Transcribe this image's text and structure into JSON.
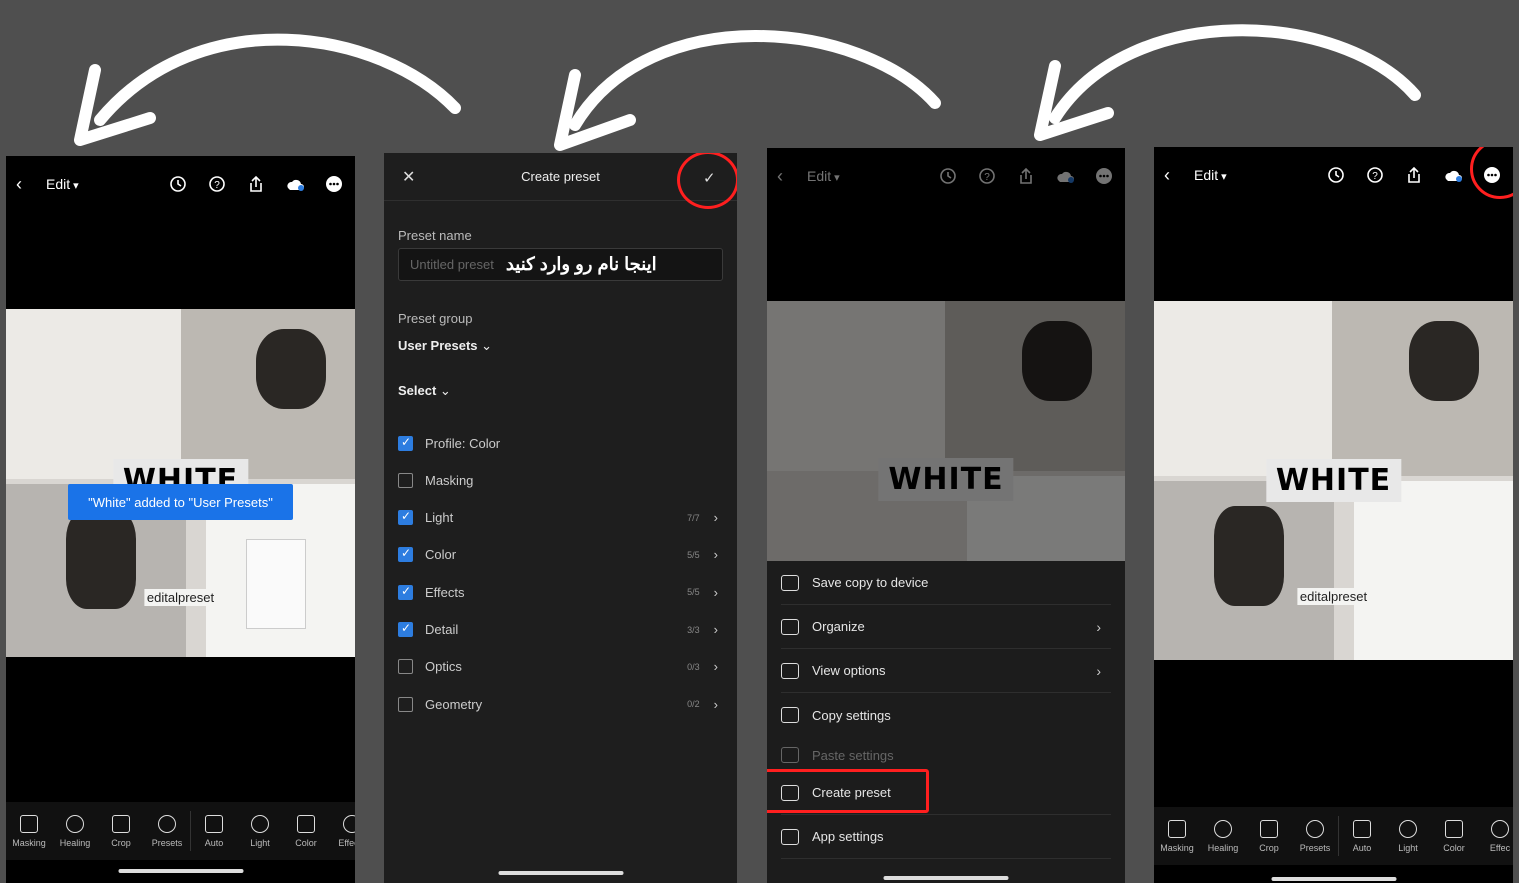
{
  "screen1": {
    "edit_label": "Edit",
    "photo_banner": "WHITE",
    "watermark": "editalpreset",
    "toast": "\"White\" added to \"User Presets\"",
    "toolbar": [
      "Masking",
      "Healing",
      "Crop",
      "Presets",
      "Auto",
      "Light",
      "Color",
      "Effects"
    ]
  },
  "screen2": {
    "title": "Create preset",
    "preset_name_label": "Preset name",
    "preset_name_placeholder": "Untitled preset",
    "preset_name_annotation": "اینجا نام رو وارد کنید",
    "preset_group_label": "Preset group",
    "preset_group_value": "User Presets",
    "select_label": "Select",
    "options": [
      {
        "label": "Profile: Color",
        "checked": true,
        "count": ""
      },
      {
        "label": "Masking",
        "checked": false,
        "count": ""
      },
      {
        "label": "Light",
        "checked": true,
        "count": "7/7"
      },
      {
        "label": "Color",
        "checked": true,
        "count": "5/5"
      },
      {
        "label": "Effects",
        "checked": true,
        "count": "5/5"
      },
      {
        "label": "Detail",
        "checked": true,
        "count": "3/3"
      },
      {
        "label": "Optics",
        "checked": false,
        "count": "0/3"
      },
      {
        "label": "Geometry",
        "checked": false,
        "count": "0/2"
      }
    ]
  },
  "screen3": {
    "edit_label": "Edit",
    "photo_banner": "WHITE",
    "menu": [
      {
        "label": "Save copy to device",
        "icon": "download-icon",
        "chevron": false,
        "dim": false
      },
      {
        "label": "Organize",
        "icon": "organize-icon",
        "chevron": true,
        "dim": false
      },
      {
        "label": "View options",
        "icon": "view-icon",
        "chevron": true,
        "dim": false
      },
      {
        "label": "Copy settings",
        "icon": "copy-settings-icon",
        "chevron": false,
        "dim": false
      },
      {
        "label": "Paste settings",
        "icon": "paste-settings-icon",
        "chevron": false,
        "dim": true
      },
      {
        "label": "Create preset",
        "icon": "create-preset-icon",
        "chevron": false,
        "dim": false
      },
      {
        "label": "App settings",
        "icon": "gear-icon",
        "chevron": false,
        "dim": false
      }
    ]
  },
  "screen4": {
    "edit_label": "Edit",
    "photo_banner": "WHITE",
    "watermark": "editalpreset",
    "toolbar": [
      "Masking",
      "Healing",
      "Crop",
      "Presets",
      "Auto",
      "Light",
      "Color",
      "Effec"
    ]
  },
  "colors": {
    "highlight": "#ff1f1f",
    "toast": "#1a73e8",
    "checkbox": "#2d7de0",
    "background": "#4f4f4f"
  }
}
